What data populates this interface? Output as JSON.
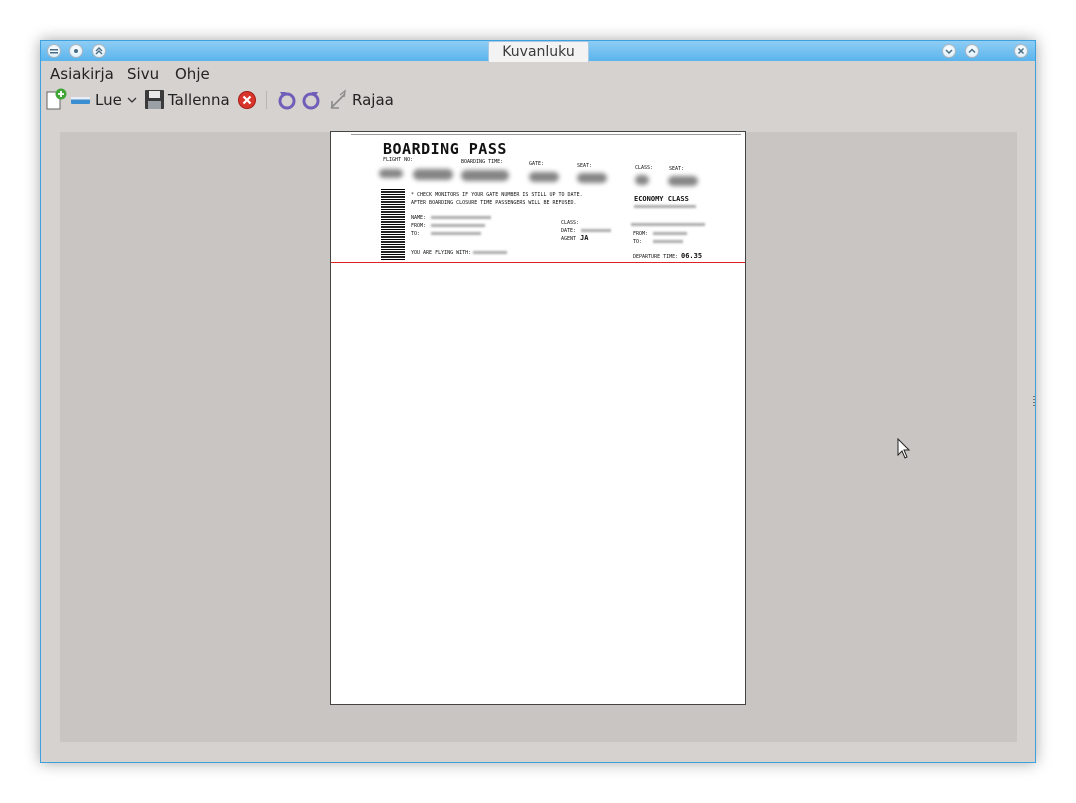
{
  "window": {
    "title": "Kuvanluku"
  },
  "menus": [
    {
      "label": "Asiakirja"
    },
    {
      "label": "Sivu"
    },
    {
      "label": "Ohje"
    }
  ],
  "toolbar": {
    "scan_label": "Lue",
    "save_label": "Tallenna",
    "crop_label": "Rajaa"
  },
  "document": {
    "heading": "BOARDING PASS",
    "flight_no": "FLIGHT NO:",
    "boarding_time": "BOARDING TIME:",
    "gate": "GATE:",
    "seat": "SEAT:",
    "class": "CLASS:",
    "seat2": "SEAT:",
    "notice1": "* CHECK MONITORS IF YOUR GATE NUMBER IS STILL UP TO DATE.",
    "notice2": "AFTER BOARDING CLOSURE TIME PASSENGERS WILL BE REFUSED.",
    "economy": "ECONOMY CLASS",
    "name": "NAME:",
    "from": "FROM:",
    "to": "TO:",
    "class2": "CLASS:",
    "date": "DATE:",
    "agent": "AGENT",
    "agent_val": "JA",
    "from2": "FROM:",
    "to2": "TO:",
    "flying_with": "YOU ARE FLYING WITH:",
    "departure": "DEPARTURE TIME:",
    "departure_val": "06.35"
  },
  "colors": {
    "accent": "#3da1e0",
    "canvas": "#c9c5c3",
    "window_bg": "#d6d2d0"
  }
}
